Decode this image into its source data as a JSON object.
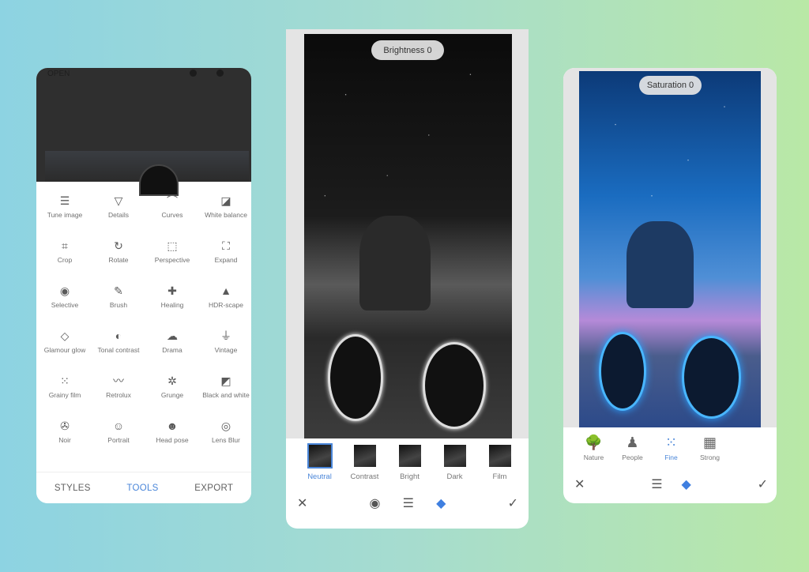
{
  "phone1": {
    "header_label": "OPEN",
    "tools": [
      {
        "label": "Tune image",
        "icon": "sliders-icon"
      },
      {
        "label": "Details",
        "icon": "triangle-icon"
      },
      {
        "label": "Curves",
        "icon": "curves-icon"
      },
      {
        "label": "White balance",
        "icon": "white-balance-icon"
      },
      {
        "label": "Crop",
        "icon": "crop-icon"
      },
      {
        "label": "Rotate",
        "icon": "rotate-icon"
      },
      {
        "label": "Perspective",
        "icon": "perspective-icon"
      },
      {
        "label": "Expand",
        "icon": "expand-icon"
      },
      {
        "label": "Selective",
        "icon": "target-icon"
      },
      {
        "label": "Brush",
        "icon": "brush-icon"
      },
      {
        "label": "Healing",
        "icon": "bandage-icon"
      },
      {
        "label": "HDR-scape",
        "icon": "mountain-icon"
      },
      {
        "label": "Glamour glow",
        "icon": "diamond-icon"
      },
      {
        "label": "Tonal contrast",
        "icon": "half-circle-icon"
      },
      {
        "label": "Drama",
        "icon": "cloud-icon"
      },
      {
        "label": "Vintage",
        "icon": "lamp-icon"
      },
      {
        "label": "Grainy film",
        "icon": "grain-icon"
      },
      {
        "label": "Retrolux",
        "icon": "mustache-icon"
      },
      {
        "label": "Grunge",
        "icon": "grunge-icon"
      },
      {
        "label": "Black and white",
        "icon": "bw-icon"
      },
      {
        "label": "Noir",
        "icon": "film-reel-icon"
      },
      {
        "label": "Portrait",
        "icon": "face-icon"
      },
      {
        "label": "Head pose",
        "icon": "face-frame-icon"
      },
      {
        "label": "Lens Blur",
        "icon": "lens-blur-icon"
      }
    ],
    "tabs": [
      {
        "label": "STYLES"
      },
      {
        "label": "TOOLS"
      },
      {
        "label": "EXPORT"
      }
    ],
    "active_tab": "TOOLS"
  },
  "phone2": {
    "pill": "Brightness 0",
    "styles": [
      "Neutral",
      "Contrast",
      "Bright",
      "Dark",
      "Film",
      "Dark"
    ],
    "selected_style": "Neutral"
  },
  "phone3": {
    "pill": "Saturation 0",
    "modes": [
      "Nature",
      "People",
      "Fine",
      "Strong"
    ],
    "selected_mode": "Fine"
  },
  "colors": {
    "accent": "#4a86d9"
  }
}
